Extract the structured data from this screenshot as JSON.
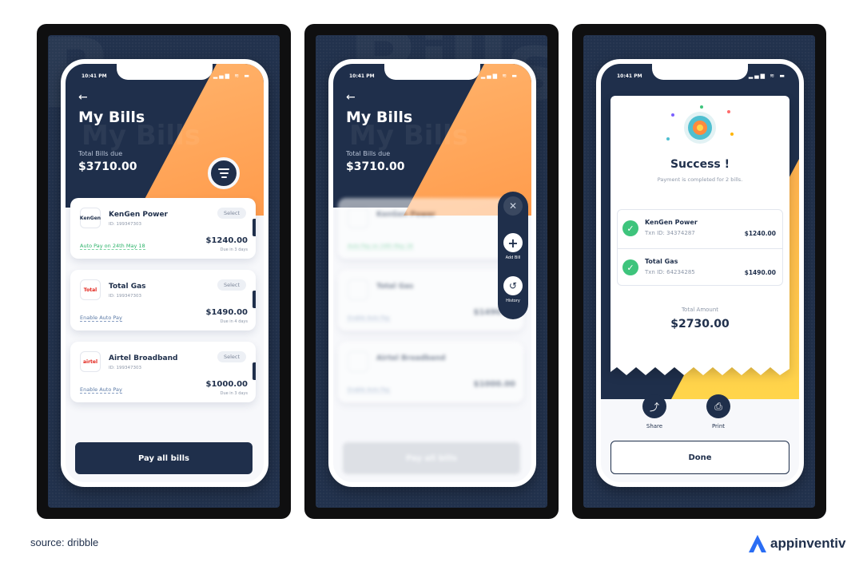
{
  "colors": {
    "navy": "#1f2f4b",
    "orange": "#ffa052",
    "green": "#3ec47c",
    "brand_blue": "#2a6df4"
  },
  "status_bar": {
    "time": "10:41 PM",
    "icons": "..ıl ≈ ▬"
  },
  "my_bills": {
    "back_icon": "arrow-left-icon",
    "title": "My Bills",
    "total_label": "Total Bills due",
    "total_amount": "$3710.00",
    "filter_icon": "filter-icon",
    "bills": [
      {
        "name": "KenGen Power",
        "id": "ID: 199347303",
        "select": "Select",
        "amount": "$1240.00",
        "due": "Due in 3 days",
        "autopay": "Auto Pay on 24th May 18",
        "autopay_active": true,
        "logo": "KenGen"
      },
      {
        "name": "Total Gas",
        "id": "ID: 199347303",
        "select": "Select",
        "amount": "$1490.00",
        "due": "Due in 4 days",
        "autopay": "Enable Auto Pay",
        "autopay_active": false,
        "logo": "Total"
      },
      {
        "name": "Airtel Broadband",
        "id": "ID: 199347303",
        "select": "Select",
        "amount": "$1000.00",
        "due": "Due in 3 days",
        "autopay": "Enable Auto Pay",
        "autopay_active": false,
        "logo": "airtel"
      }
    ],
    "pay_all": "Pay all bills"
  },
  "menu": {
    "close_icon": "close-icon",
    "add_label": "Add Bill",
    "add_icon": "plus-icon",
    "history_label": "History",
    "history_icon": "history-icon",
    "pay_all_ghost": "Pay all bills"
  },
  "success": {
    "title": "Success !",
    "subtitle": "Payment is completed for 2 bills.",
    "transactions": [
      {
        "name": "KenGen Power",
        "txn": "Txn ID: 34374287",
        "amount": "$1240.00"
      },
      {
        "name": "Total Gas",
        "txn": "Txn ID: 64234285",
        "amount": "$1490.00"
      }
    ],
    "total_label": "Total Amount",
    "total_amount": "$2730.00",
    "share": "Share",
    "print": "Print",
    "done": "Done"
  },
  "footer": {
    "source": "source: dribble",
    "brand": "appinventiv"
  }
}
